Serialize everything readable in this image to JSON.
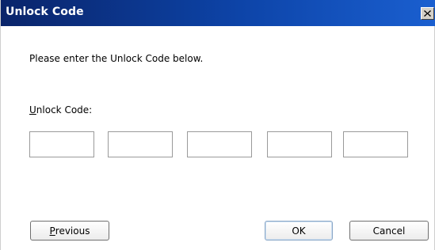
{
  "window": {
    "title": "Unlock Code",
    "close_icon": "close-icon"
  },
  "prompt": "Please enter the Unlock Code below.",
  "field": {
    "label_first": "U",
    "label_rest": "nlock Code:",
    "values": [
      "",
      "",
      "",
      "",
      ""
    ]
  },
  "buttons": {
    "previous_first": "P",
    "previous_rest": "revious",
    "ok": "OK",
    "cancel": "Cancel"
  }
}
